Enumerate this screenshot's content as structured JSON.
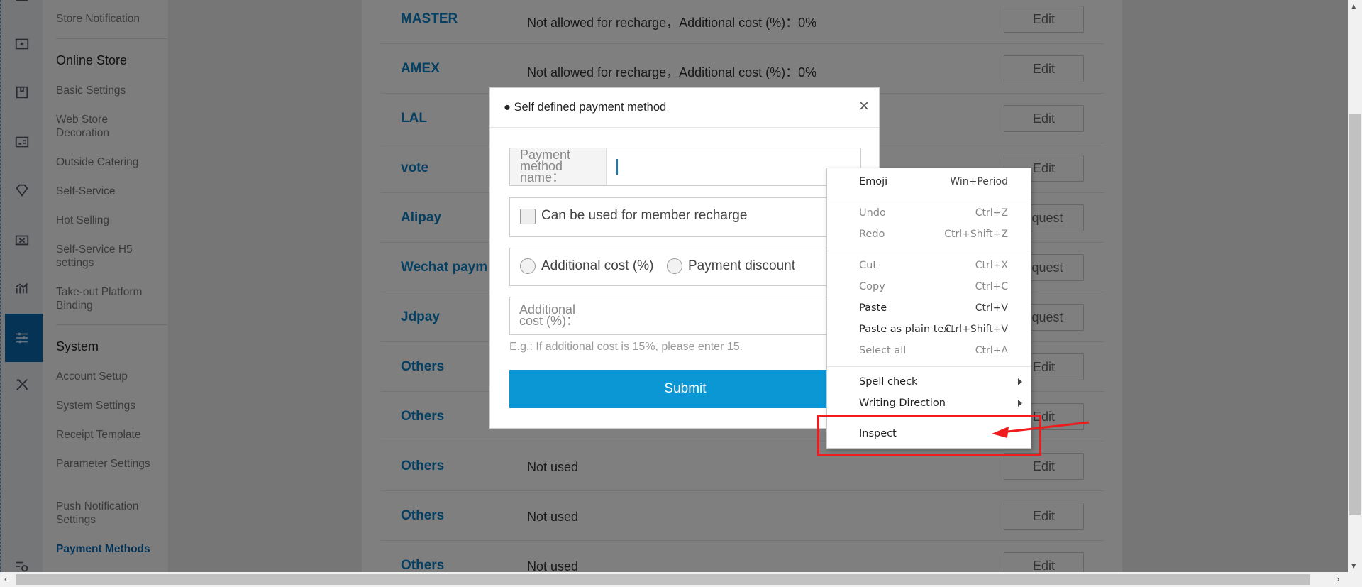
{
  "sidebar": {
    "section_items_top": [
      {
        "label": "Store Notification"
      }
    ],
    "online_store_heading": "Online Store",
    "online_store_items": [
      {
        "label": "Basic Settings"
      },
      {
        "label": "Web Store Decoration"
      },
      {
        "label": "Outside Catering"
      },
      {
        "label": "Self-Service"
      },
      {
        "label": "Hot Selling"
      },
      {
        "label": "Self-Service H5 settings"
      },
      {
        "label": "Take-out Platform Binding"
      }
    ],
    "system_heading": "System",
    "system_items": [
      {
        "label": "Account Setup"
      },
      {
        "label": "System Settings"
      },
      {
        "label": "Receipt Template"
      },
      {
        "label": "Parameter Settings"
      },
      {
        "label": "Push Notification Settings"
      },
      {
        "label": "Payment Methods"
      }
    ]
  },
  "rail_icons": [
    "money-icon",
    "box-icon",
    "id-card-icon",
    "diamond-icon",
    "ticket-icon",
    "chart-icon",
    "settings-sliders-icon",
    "tools-icon",
    "list-search-icon"
  ],
  "payment_rows": [
    {
      "name": "MASTER",
      "desc": "Not allowed for recharge，Additional cost (%)：0%",
      "action": "Edit"
    },
    {
      "name": "AMEX",
      "desc": "Not allowed for recharge，Additional cost (%)：0%",
      "action": "Edit"
    },
    {
      "name": "LAL",
      "desc": "",
      "action": "Edit"
    },
    {
      "name": "vote",
      "desc": "",
      "action": "Edit"
    },
    {
      "name": "Alipay",
      "desc": "",
      "action": "equest"
    },
    {
      "name": "Wechat paym",
      "desc": "",
      "action": "equest"
    },
    {
      "name": "Jdpay",
      "desc": "",
      "action": "equest"
    },
    {
      "name": "Others",
      "desc": "",
      "action": "Edit"
    },
    {
      "name": "Others",
      "desc": "",
      "action": "Edit"
    },
    {
      "name": "Others",
      "desc": "Not used",
      "action": "Edit"
    },
    {
      "name": "Others",
      "desc": "Not used",
      "action": "Edit"
    },
    {
      "name": "Others",
      "desc": "Not used",
      "action": "Edit"
    }
  ],
  "modal": {
    "title": "● Self defined payment method",
    "close": "×",
    "name_label": "Payment method name：",
    "name_value": "",
    "member_recharge_label": "Can be used for member recharge",
    "option_additional_cost": "Additional cost (%)",
    "option_payment_discount": "Payment discount",
    "additional_cost_label": "Additional cost (%)：",
    "hint": "E.g.: If additional cost is 15%, please enter 15.",
    "submit": "Submit"
  },
  "context_menu": {
    "items": [
      {
        "label": "Emoji",
        "shortcut": "Win+Period",
        "disabled": false
      },
      {
        "label": "Undo",
        "shortcut": "Ctrl+Z",
        "disabled": true
      },
      {
        "label": "Redo",
        "shortcut": "Ctrl+Shift+Z",
        "disabled": true
      },
      {
        "label": "Cut",
        "shortcut": "Ctrl+X",
        "disabled": true
      },
      {
        "label": "Copy",
        "shortcut": "Ctrl+C",
        "disabled": true
      },
      {
        "label": "Paste",
        "shortcut": "Ctrl+V",
        "disabled": false
      },
      {
        "label": "Paste as plain text",
        "shortcut": "Ctrl+Shift+V",
        "disabled": false
      },
      {
        "label": "Select all",
        "shortcut": "Ctrl+A",
        "disabled": true
      },
      {
        "label": "Spell check",
        "shortcut": "",
        "disabled": false
      },
      {
        "label": "Writing Direction",
        "shortcut": "",
        "disabled": false
      },
      {
        "label": "Inspect",
        "shortcut": "",
        "disabled": false
      }
    ]
  },
  "colors": {
    "accent": "#0a97d4",
    "link_blue": "#0a7ec2",
    "rail_active": "#0a67ad",
    "annotation_red": "#ee1c1c"
  }
}
